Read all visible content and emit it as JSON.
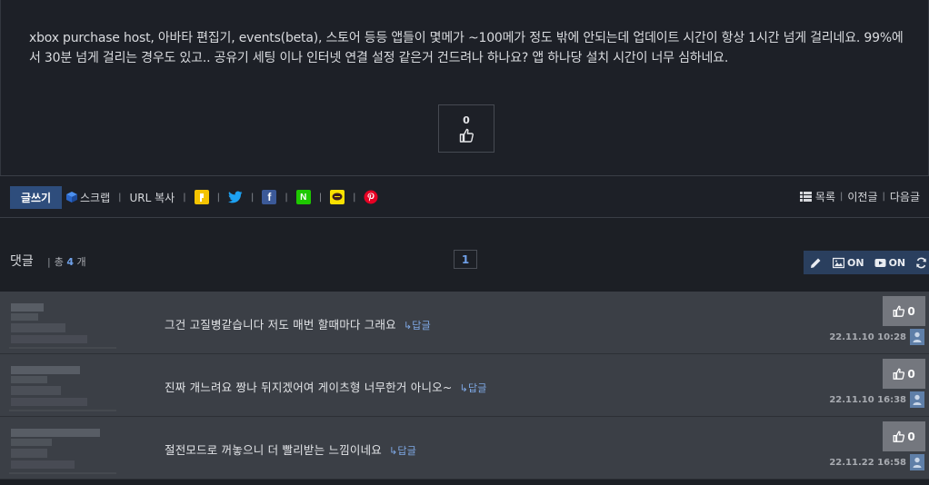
{
  "post": {
    "body": "xbox purchase host, 아바타 편집기, events(beta), 스토어 등등 앱들이 몇메가 ~100메가 정도 밖에 안되는데 업데이트 시간이 항상 1시간 넘게 걸리네요. 99%에서 30분 넘게 걸리는 경우도 있고.. 공유기 세팅 이나 인터넷 연결 설정 같은거 건드려나 하나요? 앱 하나당 설치 시간이 너무 심하네요.",
    "like_count": "0"
  },
  "actions": {
    "write_label": "글쓰기",
    "scrap_label": "스크랩",
    "url_copy_label": "URL 복사",
    "share_icons": [
      "kakaostory-icon",
      "twitter-icon",
      "facebook-icon",
      "naver-icon",
      "kakaotalk-icon",
      "pinterest-icon"
    ],
    "list_label": "목록",
    "prev_label": "이전글",
    "next_label": "다음글"
  },
  "comments_header": {
    "title": "댓글",
    "count_prefix": "총",
    "count": "4",
    "count_suffix": "개",
    "page": "1",
    "image_toggle": "ON",
    "video_toggle": "ON"
  },
  "comments": [
    {
      "text": "그건 고질병같습니다 저도 매번 할때마다 그래요",
      "reply": "답글",
      "likes": "0",
      "time": "22.11.10 10:28"
    },
    {
      "text": "진짜 개느려요 짱나 뒤지겠어여 게이츠형 너무한거 아니오~",
      "reply": "답글",
      "likes": "0",
      "time": "22.11.10 16:38"
    },
    {
      "text": "절전모드로 꺼놓으니 더 빨리받는 느낌이네요",
      "reply": "답글",
      "likes": "0",
      "time": "22.11.22 16:58"
    }
  ],
  "colors": {
    "accent_blue": "#2e4d7c",
    "link_blue": "#6fa0e8",
    "comment_bg": "#3b3f46"
  }
}
